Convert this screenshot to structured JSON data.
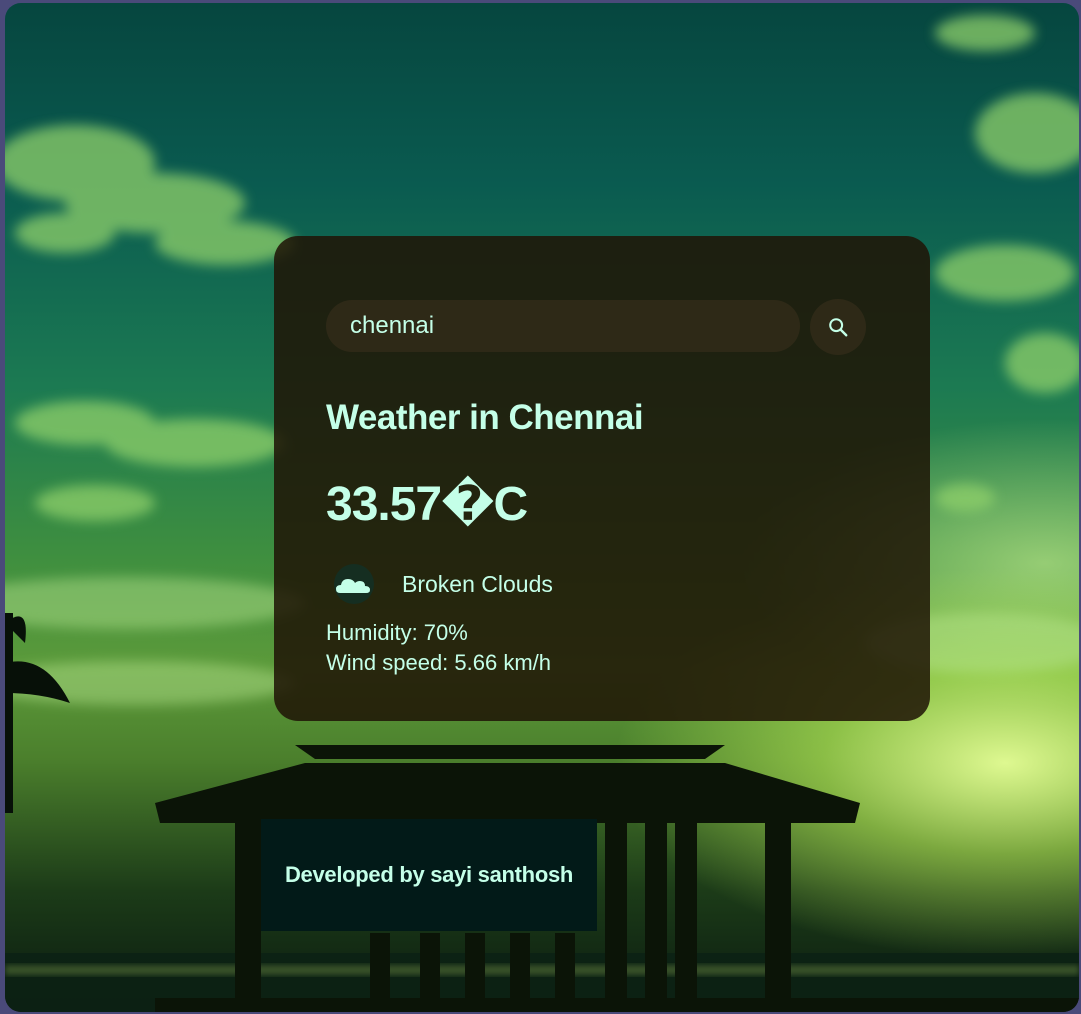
{
  "search": {
    "value": "chennai",
    "icon": "search-icon"
  },
  "weather": {
    "title": "Weather in Chennai",
    "temperature": "33.57�C",
    "condition_icon": "cloud-icon",
    "condition": "Broken Clouds",
    "humidity": "Humidity: 70%",
    "wind": "Wind speed: 5.66 km/h"
  },
  "footer": {
    "text": "Developed by sayi santhosh"
  },
  "colors": {
    "text": "#c4ffe8",
    "card_bg": "#201406",
    "footer_bg": "#021a18"
  }
}
